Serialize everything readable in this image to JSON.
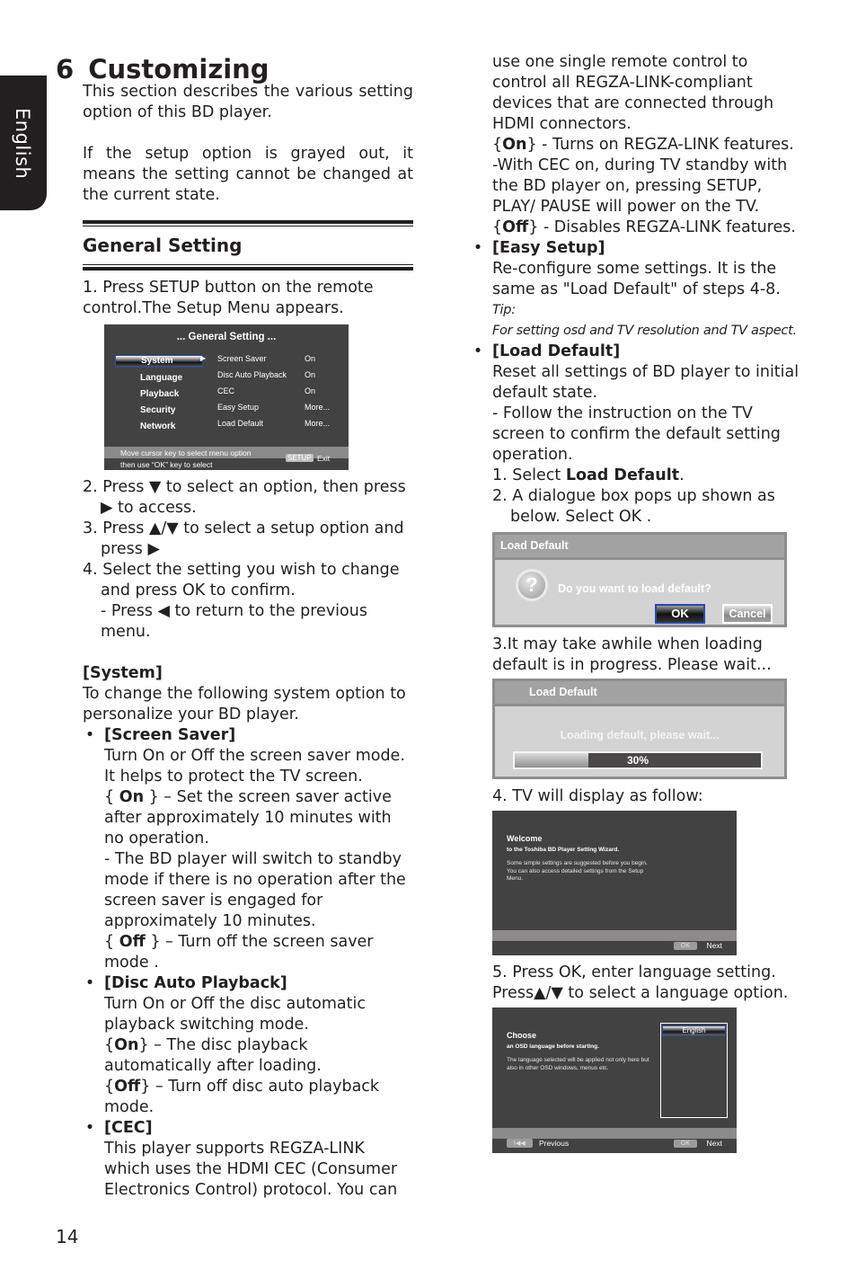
{
  "side_tab": {
    "label": "English"
  },
  "chapter": {
    "number": "6",
    "title": "Customizing"
  },
  "intro": [
    "This section describes the various setting option of this BD player.",
    "If the setup option is grayed out, it means the setting cannot be changed at the current state."
  ],
  "general_setting": {
    "title": "General Setting",
    "step1": "1. Press SETUP button on the remote control.The Setup Menu appears.",
    "step2a": "2. Press ▼ to select an option, then press",
    "step2b": "▶ to access.",
    "step3a": "3. Press ▲/▼ to select a setup option and",
    "step3b": "press ▶",
    "step4a": "4. Select the setting you wish to change",
    "step4b": "and press OK to confirm.",
    "step4c": "- Press ◀ to return to the previous menu."
  },
  "setup_menu_screen": {
    "title": "... General Setting ...",
    "categories": [
      "System",
      "Language",
      "Playback",
      "Security",
      "Network"
    ],
    "selected_category": "System",
    "options": [
      {
        "label": "Screen Saver",
        "value": "On"
      },
      {
        "label": "Disc Auto Playback",
        "value": "On"
      },
      {
        "label": "CEC",
        "value": "On"
      },
      {
        "label": "Easy Setup",
        "value": "More..."
      },
      {
        "label": "Load Default",
        "value": "More..."
      }
    ],
    "footer_line1": "Move cursor key to select menu option",
    "footer_line2": "then use “OK” key to select",
    "setup_key": "SETUP",
    "exit_label": "Exit"
  },
  "system": {
    "title": "[System]",
    "intro": "To change the following system option to personalize your BD player.",
    "screen_saver": {
      "title": "[Screen Saver]",
      "desc": "Turn On or Off the screen saver mode. It helps to protect the TV screen.",
      "on_label": "On",
      "on_desc": " } – Set the screen saver active after approximately 10 minutes with no operation.",
      "note": "- The BD player will switch to standby mode if there is no operation after the screen saver is engaged for approximately 10 minutes.",
      "off_label": "Off",
      "off_desc": " } – Turn off the screen saver mode ."
    },
    "disc_auto_playback": {
      "title": "[Disc Auto Playback]",
      "desc": "Turn On or Off the disc automatic playback switching mode.",
      "on_label": "On",
      "on_desc": "} – The disc playback automatically after loading.",
      "off_label": "Off",
      "off_desc": "} – Turn off disc auto playback mode."
    },
    "cec": {
      "title": "[CEC]",
      "desc": "This player supports REGZA-LINK which uses the HDMI CEC (Consumer Electronics Control) protocol. You can",
      "desc_cont": "use one single remote control to control all REGZA-LINK-compliant devices that are connected through HDMI connectors.",
      "on_label": "On",
      "on_desc": "} - Turns on REGZA-LINK features.",
      "note": "-With CEC on, during TV standby with the BD player on, pressing SETUP, PLAY/ PAUSE will  power on the TV.",
      "off_label": "Off",
      "off_desc": "} - Disables REGZA-LINK features."
    },
    "easy_setup": {
      "title": "[Easy Setup]",
      "desc": "Re-configure some settings. It is the same as \"Load Default\" of steps 4-8.",
      "tip_label": "Tip:",
      "tip": "For setting osd and TV resolution and TV aspect."
    },
    "load_default": {
      "title": "[Load Default]",
      "desc": "Reset all settings of BD player to initial default state.",
      "note": "- Follow the instruction on the TV screen to confirm the default setting operation.",
      "step1_prefix": "1. Select ",
      "step1_bold": "Load Default",
      "step1_suffix": ".",
      "step2a": "2. A dialogue box pops up shown as",
      "step2b": "below. Select OK .",
      "step3": "3.It may take awhile when loading default is in progress. Please wait...",
      "step4": "4. TV will display as follow:",
      "step5a": "5. Press OK, enter language setting.",
      "step5b": "Press▲/▼ to select a language option."
    }
  },
  "confirm_dialog": {
    "title": "Load Default",
    "message": "Do you want to load default?",
    "ok_label": "OK",
    "cancel_label": "Cancel",
    "icon": "question-icon"
  },
  "loading_dialog": {
    "title": "Load Default",
    "message": "Loading default, please wait...",
    "progress_percent": 30,
    "progress_label": "30%"
  },
  "welcome_screen": {
    "title": "Welcome",
    "subtitle": "to the Toshiba BD Player Setting Wizard.",
    "desc": "Some simple settings are suggested before you begin. You can also access detailed settings from the Setup Menu.",
    "ok_key": "OK",
    "next_label": "Next"
  },
  "language_screen": {
    "title": "Choose",
    "subtitle": "an OSD language before starting.",
    "desc": "The language selected will be applied not only here but also in other OSD windows, menus etc.",
    "selected_language": "English",
    "prev_key": "I◀◀",
    "prev_label": "Previous",
    "ok_key": "OK",
    "next_label": "Next"
  },
  "page_number": "14"
}
